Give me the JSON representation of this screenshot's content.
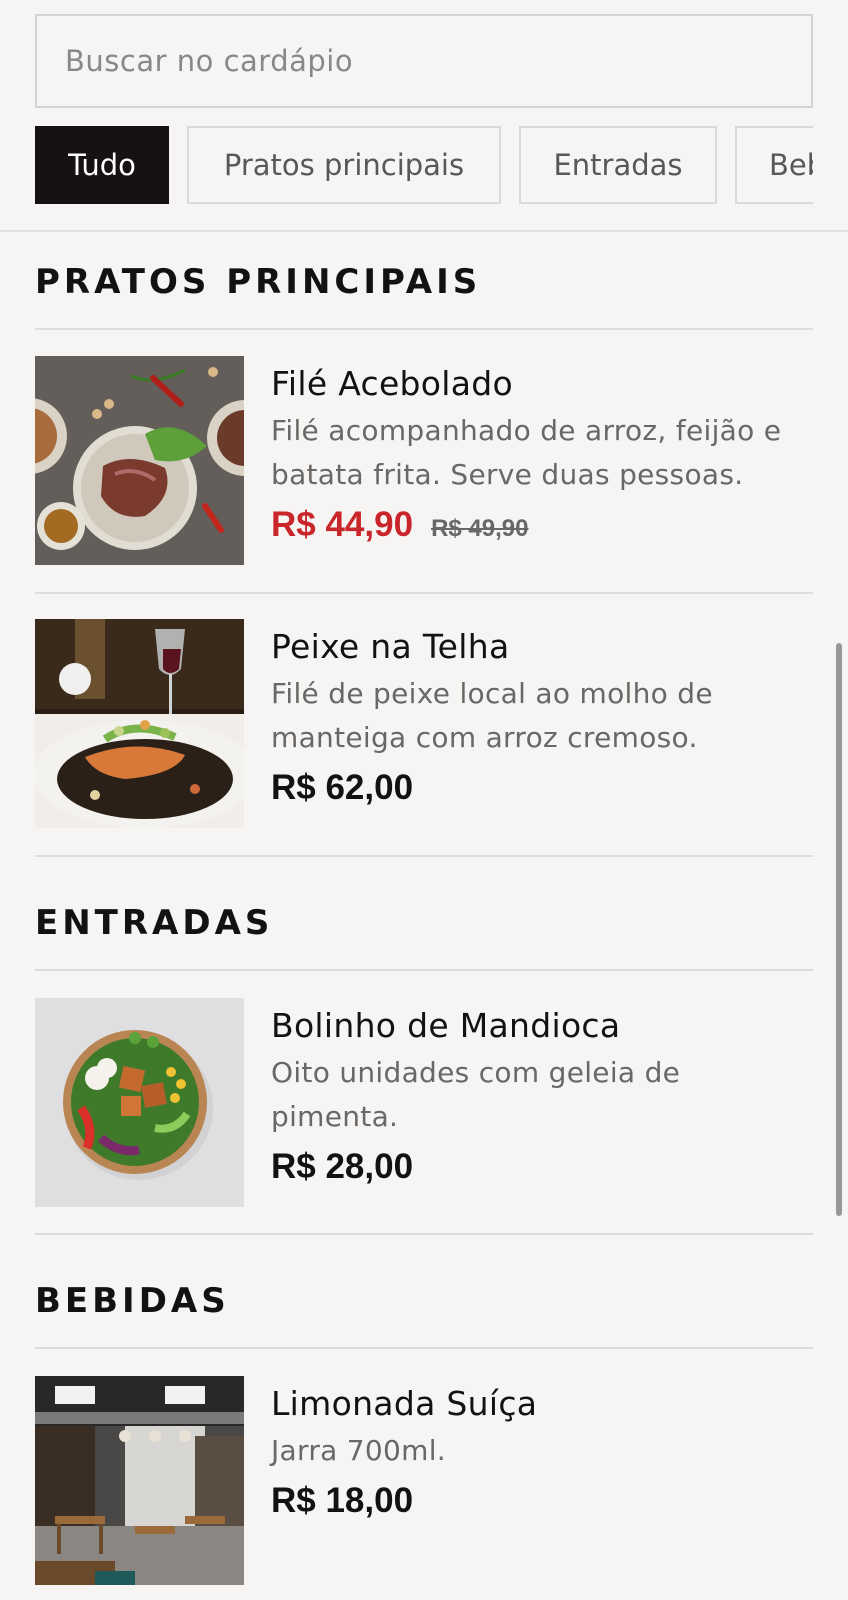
{
  "search": {
    "placeholder": "Buscar no cardápio"
  },
  "categories": [
    {
      "label": "Tudo",
      "active": true
    },
    {
      "label": "Pratos principais",
      "active": false
    },
    {
      "label": "Entradas",
      "active": false
    },
    {
      "label": "Beb",
      "active": false
    }
  ],
  "sections": [
    {
      "title": "PRATOS PRINCIPAIS",
      "items": [
        {
          "name": "Filé Acebolado",
          "description": "Filé acompanhado de arroz, feijão e batata frita. Serve duas pessoas.",
          "price": "R$ 44,90",
          "old_price": "R$ 49,90",
          "image": "steak-plate-photo"
        },
        {
          "name": "Peixe na Telha",
          "description": "Filé de peixe local ao molho de manteiga com arroz cremoso.",
          "price": "R$ 62,00",
          "image": "salmon-plate-photo"
        }
      ]
    },
    {
      "title": "ENTRADAS",
      "items": [
        {
          "name": "Bolinho de Mandioca",
          "description": "Oito unidades com geleia de pimenta.",
          "price": "R$ 28,00",
          "image": "salad-bowl-photo"
        }
      ]
    },
    {
      "title": "BEBIDAS",
      "items": [
        {
          "name": "Limonada Suíça",
          "description": "Jarra 700ml.",
          "price": "R$ 18,00",
          "image": "restaurant-interior-photo"
        }
      ]
    }
  ],
  "colors": {
    "sale_price": "#c8262a",
    "active_chip": "#161211",
    "background": "#f6f5f4"
  }
}
